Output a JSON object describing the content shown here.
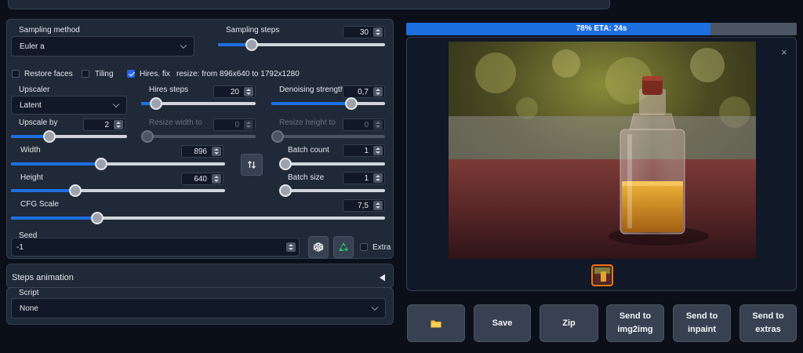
{
  "sampling": {
    "method_label": "Sampling method",
    "method_value": "Euler a",
    "steps_label": "Sampling steps",
    "steps_value": "30",
    "steps_fraction": 0.2
  },
  "checkboxes": {
    "restore_faces": {
      "label": "Restore faces",
      "checked": false
    },
    "tiling": {
      "label": "Tiling",
      "checked": false
    },
    "hires_fix": {
      "label": "Hires. fix",
      "checked": true
    },
    "resize_text": "resize: from 896x640 to 1792x1280"
  },
  "hires": {
    "upscaler_label": "Upscaler",
    "upscaler_value": "Latent",
    "hires_steps_label": "Hires steps",
    "hires_steps_value": "20",
    "hires_steps_fraction": 0.13,
    "denoising_label": "Denoising strength",
    "denoising_value": "0,7",
    "denoising_fraction": 0.7,
    "upscale_by_label": "Upscale by",
    "upscale_by_value": "2",
    "upscale_by_fraction": 0.33,
    "resize_width_label": "Resize width to",
    "resize_width_value": "0",
    "resize_height_label": "Resize height to",
    "resize_height_value": "0"
  },
  "size": {
    "width_label": "Width",
    "width_value": "896",
    "width_fraction": 0.42,
    "height_label": "Height",
    "height_value": "640",
    "height_fraction": 0.3,
    "swap_icon": "swap-arrows-icon",
    "batch_count_label": "Batch count",
    "batch_count_value": "1",
    "batch_count_fraction": 0.0,
    "batch_size_label": "Batch size",
    "batch_size_value": "1",
    "batch_size_fraction": 0.0
  },
  "cfg": {
    "label": "CFG Scale",
    "value": "7,5",
    "fraction": 0.23
  },
  "seed": {
    "label": "Seed",
    "value": "-1",
    "dice_icon": "dice-icon",
    "recycle_icon": "recycle-icon",
    "extra_label": "Extra"
  },
  "steps_animation": {
    "label": "Steps animation",
    "collapse_icon": "triangle-left-icon"
  },
  "script": {
    "label": "Script",
    "value": "None"
  },
  "progress": {
    "text": "78% ETA: 24s",
    "fraction": 0.78
  },
  "gallery": {
    "close_icon": "close-icon"
  },
  "actions": {
    "folder_icon": "folder-icon",
    "save": "Save",
    "zip": "Zip",
    "img2img": "Send to img2img",
    "img2img_l1": "Send to",
    "img2img_l2": "img2img",
    "inpaint_l1": "Send to",
    "inpaint_l2": "inpaint",
    "extras_l1": "Send to",
    "extras_l2": "extras"
  },
  "colors": {
    "accent": "#1d6fe0",
    "background": "#0b0f19",
    "panel": "#1f2937"
  }
}
